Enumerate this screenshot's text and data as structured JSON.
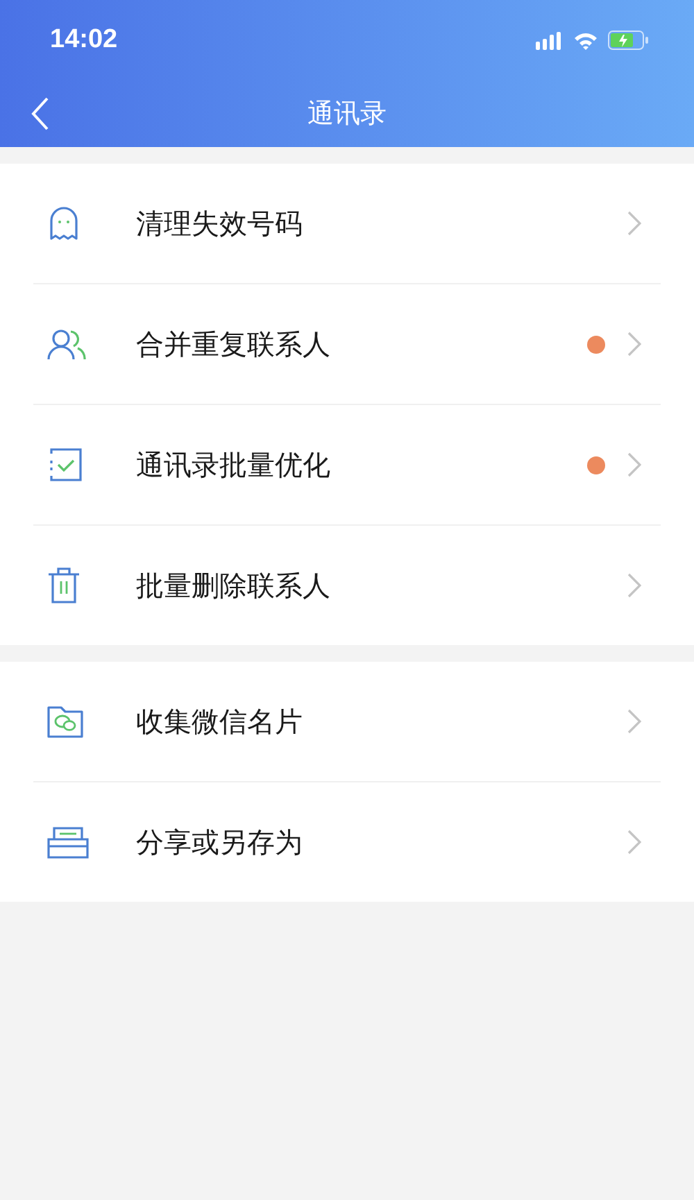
{
  "status_bar": {
    "time": "14:02"
  },
  "nav": {
    "title": "通讯录"
  },
  "sections": [
    {
      "items": [
        {
          "label": "清理失效号码",
          "kind": "ghost",
          "dot": false
        },
        {
          "label": "合并重复联系人",
          "kind": "people",
          "dot": true
        },
        {
          "label": "通讯录批量优化",
          "kind": "checklist",
          "dot": true
        },
        {
          "label": "批量删除联系人",
          "kind": "trash",
          "dot": false
        }
      ]
    },
    {
      "items": [
        {
          "label": "收集微信名片",
          "kind": "chat-folder",
          "dot": false
        },
        {
          "label": "分享或另存为",
          "kind": "tray",
          "dot": false
        }
      ]
    }
  ]
}
